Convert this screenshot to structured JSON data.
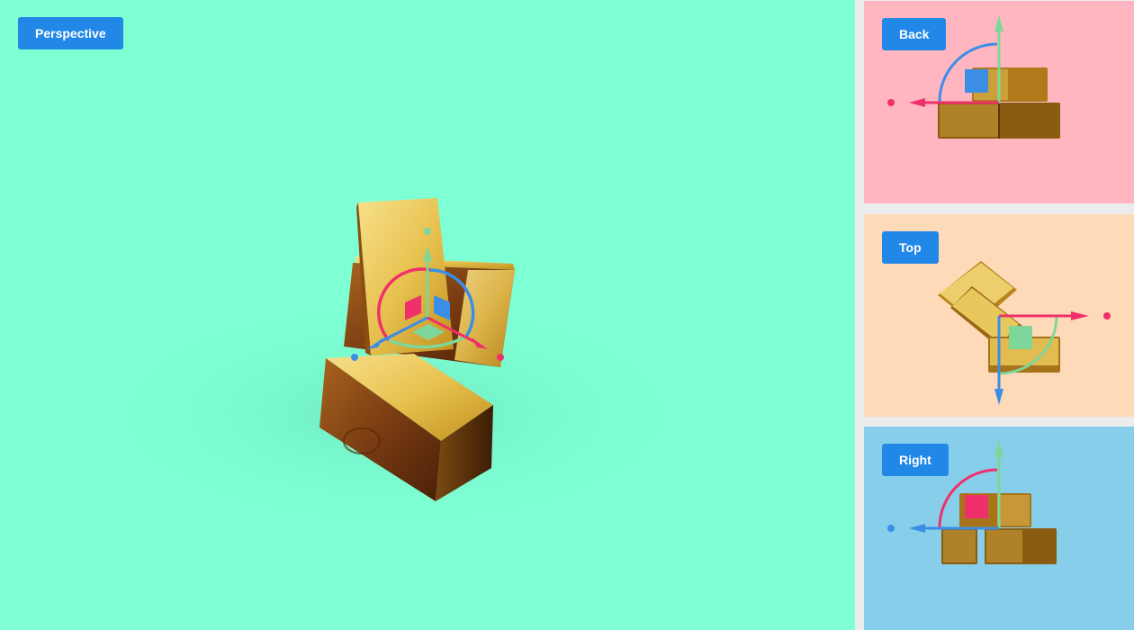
{
  "viewports": {
    "perspective": {
      "label": "Perspective"
    },
    "back": {
      "label": "Back"
    },
    "top": {
      "label": "Top"
    },
    "right": {
      "label": "Right"
    }
  },
  "colors": {
    "perspective_bg": "#7fffd4",
    "back_bg": "#ffb6c1",
    "top_bg": "#ffdab9",
    "right_bg": "#87ceeb",
    "button": "#2288e8",
    "axis_x": "#f0306a",
    "axis_y": "#7ed69a",
    "axis_z": "#3a8ee6"
  },
  "gizmo_icons": [
    "translate-arrow-icon",
    "rotate-arc-icon",
    "plane-handle-icon"
  ]
}
